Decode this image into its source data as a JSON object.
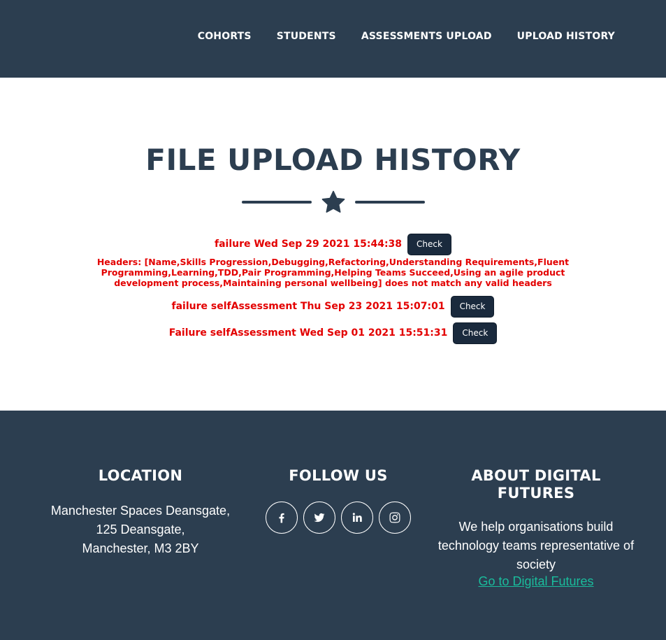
{
  "nav": {
    "items": [
      {
        "label": "COHORTS"
      },
      {
        "label": "STUDENTS"
      },
      {
        "label": "ASSESSMENTS UPLOAD"
      },
      {
        "label": "UPLOAD HISTORY"
      }
    ]
  },
  "main": {
    "title": "FILE UPLOAD HISTORY",
    "divider_icon": "star-icon",
    "records": [
      {
        "text": "failure Wed Sep 29 2021 15:44:38",
        "button": "Check",
        "detail": "Headers: [Name,Skills Progression,Debugging,Refactoring,Understanding Requirements,Fluent Programming,Learning,TDD,Pair Programming,Helping Teams Succeed,Using an agile product development process,Maintaining personal wellbeing] does not match any valid headers"
      },
      {
        "text": "failure selfAssessment Thu Sep 23 2021 15:07:01",
        "button": "Check"
      },
      {
        "text": "Failure selfAssessment Wed Sep 01 2021 15:51:31",
        "button": "Check"
      }
    ],
    "status_color": "#e30000"
  },
  "footer": {
    "location": {
      "heading": "LOCATION",
      "line1": "Manchester Spaces Deansgate,",
      "line2": "125 Deansgate,",
      "line3": "Manchester, M3 2BY"
    },
    "follow": {
      "heading": "FOLLOW US",
      "icons": [
        "facebook-icon",
        "twitter-icon",
        "linkedin-icon",
        "instagram-icon"
      ]
    },
    "about": {
      "heading": "ABOUT DIGITAL FUTURES",
      "text": "We help organisations build technology teams representative of society",
      "link": "Go to Digital Futures"
    }
  },
  "colors": {
    "primary": "#2c3e50",
    "accent": "#1abc9c",
    "button": "#1a2a3d"
  }
}
